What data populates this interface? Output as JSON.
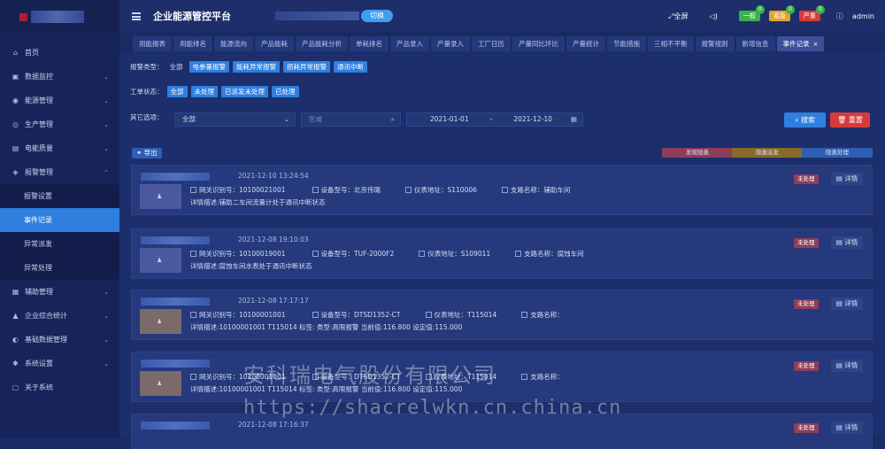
{
  "sidebar": {
    "items": [
      {
        "label": "首页",
        "icon": "home-icon"
      },
      {
        "label": "数据监控",
        "icon": "monitor-icon"
      },
      {
        "label": "能源管理",
        "icon": "energy-icon"
      },
      {
        "label": "生产管理",
        "icon": "production-icon"
      },
      {
        "label": "电能质量",
        "icon": "power-quality-icon"
      },
      {
        "label": "报警管理",
        "icon": "alarm-icon"
      },
      {
        "label": "报警设置",
        "icon": ""
      },
      {
        "label": "事件记录",
        "icon": ""
      },
      {
        "label": "异常派发",
        "icon": ""
      },
      {
        "label": "异常处理",
        "icon": ""
      },
      {
        "label": "辅助管理",
        "icon": "assist-icon"
      },
      {
        "label": "企业综合统计",
        "icon": "stats-icon"
      },
      {
        "label": "基础数据管理",
        "icon": "data-icon"
      },
      {
        "label": "系统设置",
        "icon": "settings-icon"
      },
      {
        "label": "关于系统",
        "icon": "about-icon"
      }
    ]
  },
  "header": {
    "title": "企业能源管控平台",
    "switch_label": "切换",
    "fullscreen_label": "全屏",
    "badges": [
      {
        "label": "一般",
        "count": "0",
        "color": "#38b24a"
      },
      {
        "label": "紧急",
        "count": "0",
        "color": "#e6a42a"
      },
      {
        "label": "严重",
        "count": "0",
        "color": "#d83b3b"
      }
    ],
    "user": "admin"
  },
  "tabs": [
    "用能报表",
    "用能排名",
    "能源流向",
    "产品能耗",
    "产品能耗分析",
    "单耗排名",
    "产品录入",
    "产量录入",
    "工厂日历",
    "产量同比环比",
    "产量统计",
    "节能措施",
    "三相不平衡",
    "报警规则",
    "新增信息",
    "事件记录"
  ],
  "filters": {
    "alarm_type_label": "报警类型：",
    "alarm_types": [
      "全部",
      "电参量报警",
      "能耗异常报警",
      "损耗异常报警",
      "通讯中断"
    ],
    "order_status_label": "工单状态：",
    "order_statuses": [
      "全部",
      "未处理",
      "已派发未处理",
      "已处理"
    ],
    "other_label": "其它选项：",
    "select_all": "全部",
    "region_placeholder": "区域",
    "date_start": "2021-01-01",
    "date_sep": "-",
    "date_end": "2021-12-10",
    "search_label": "搜索",
    "reset_label": "重置"
  },
  "export_label": "导出",
  "legend": [
    "发现隐患",
    "隐患派发",
    "隐患处理"
  ],
  "events": [
    {
      "time": "2021-12-10 13:24:54",
      "gateway": "网关识别号：10100021001",
      "model": "设备型号：北京伟璐",
      "meter": "仪表地址：S110006",
      "branch": "支路名称：辅助车间",
      "desc": "详情描述:辅助二车间流量计处于通讯中断状态",
      "status": "未处理",
      "detail": "详情"
    },
    {
      "time": "2021-12-08 19:10:03",
      "gateway": "网关识别号：10100019001",
      "model": "设备型号：TUF-2000F2",
      "meter": "仪表地址：S109011",
      "branch": "支路名称：腐蚀车间",
      "desc": "详情描述:腐蚀车间水表处于通讯中断状态",
      "status": "未处理",
      "detail": "详情"
    },
    {
      "time": "2021-12-08 17:17:17",
      "gateway": "网关识别号：10100001001",
      "model": "设备型号：DTSD1352-CT",
      "meter": "仪表地址：T115014",
      "branch": "支路名称：",
      "desc": "详情描述:10100001001 T115014 标签: 类型:高限报警 当前值:116.800 设定值:115.000",
      "status": "未处理",
      "detail": "详情"
    },
    {
      "time": "",
      "gateway": "网关识别号：10100001001",
      "model": "设备型号：DTSD1352-CT",
      "meter": "仪表地址：T115014",
      "branch": "支路名称：",
      "desc": "详情描述:10100001001 T115014 标签: 类型:高限报警 当前值:116.800 设定值:115.000",
      "status": "未处理",
      "detail": "详情"
    },
    {
      "time": "2021-12-08 17:16:37",
      "gateway": "",
      "model": "",
      "meter": "",
      "branch": "",
      "desc": "",
      "status": "未处理",
      "detail": "详情"
    }
  ],
  "watermark": {
    "line1": "安科瑞电气股份有限公司",
    "line2": "https://shacrelwkn.cn.china.cn"
  }
}
